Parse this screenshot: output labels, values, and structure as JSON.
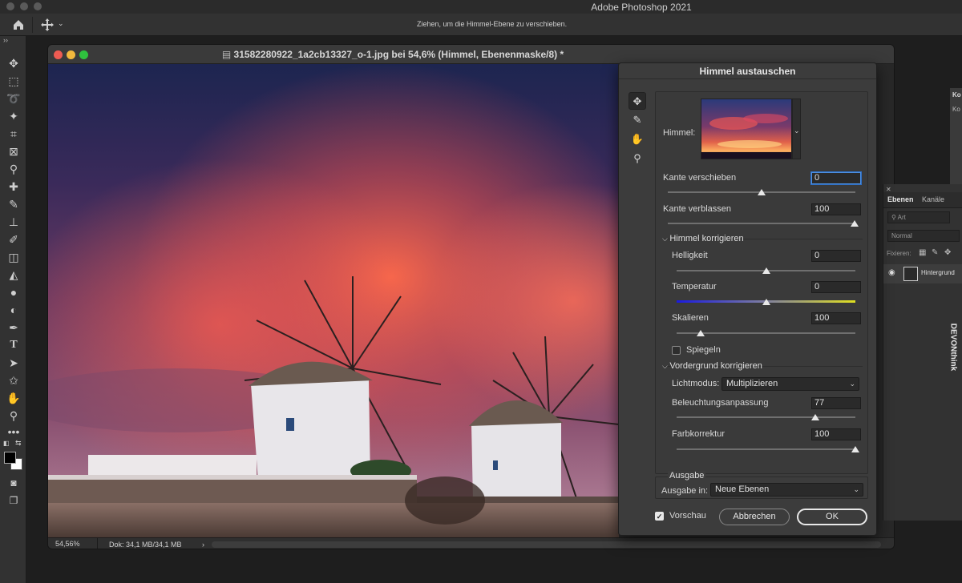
{
  "app": {
    "title": "Adobe Photoshop 2021"
  },
  "options_bar": {
    "hint": "Ziehen, um die Himmel-Ebene zu verschieben."
  },
  "document": {
    "title": "31582280922_1a2cb13327_o-1.jpg bei 54,6% (Himmel, Ebenenmaske/8) *",
    "zoom": "54,56%",
    "doc_size": "Dok: 34,1 MB/34,1 MB"
  },
  "dialog": {
    "title": "Himmel austauschen",
    "sky_label": "Himmel:",
    "edge_shift": {
      "label": "Kante verschieben",
      "value": "0",
      "slider": 0.5
    },
    "edge_fade": {
      "label": "Kante verblassen",
      "value": "100",
      "slider": 1.0
    },
    "sky_adjust": {
      "header": "Himmel korrigieren",
      "brightness": {
        "label": "Helligkeit",
        "value": "0",
        "slider": 0.5
      },
      "temperature": {
        "label": "Temperatur",
        "value": "0",
        "slider": 0.5
      },
      "scale": {
        "label": "Skalieren",
        "value": "100",
        "slider": 0.13
      },
      "flip": {
        "label": "Spiegeln",
        "checked": false
      }
    },
    "foreground_adjust": {
      "header": "Vordergrund korrigieren",
      "lighting_mode": {
        "label": "Lichtmodus:",
        "value": "Multiplizieren"
      },
      "lighting_adjust": {
        "label": "Beleuchtungsanpassung",
        "value": "77",
        "slider": 0.77
      },
      "color_adjust": {
        "label": "Farbkorrektur",
        "value": "100",
        "slider": 1.0
      }
    },
    "output": {
      "header": "Ausgabe",
      "label": "Ausgabe in:",
      "value": "Neue Ebenen"
    },
    "preview": {
      "label": "Vorschau",
      "checked": true
    },
    "cancel_label": "Abbrechen",
    "ok_label": "OK"
  },
  "layers_panel": {
    "tab_layers": "Ebenen",
    "tab_channels": "Kanäle",
    "filter_placeholder": "Art",
    "blend_mode": "Normal",
    "lock_label": "Fixieren:",
    "layer_name": "Hintergrund"
  },
  "side_panel": {
    "label_a": "Ko",
    "label_b": "Ko"
  },
  "devonthink": {
    "label": "DEVONthink"
  },
  "colors": {
    "accent_blue": "#4d8fe0",
    "close_red": "#ee5b52",
    "min_yellow": "#f2b83d",
    "max_green": "#2fc13e"
  }
}
